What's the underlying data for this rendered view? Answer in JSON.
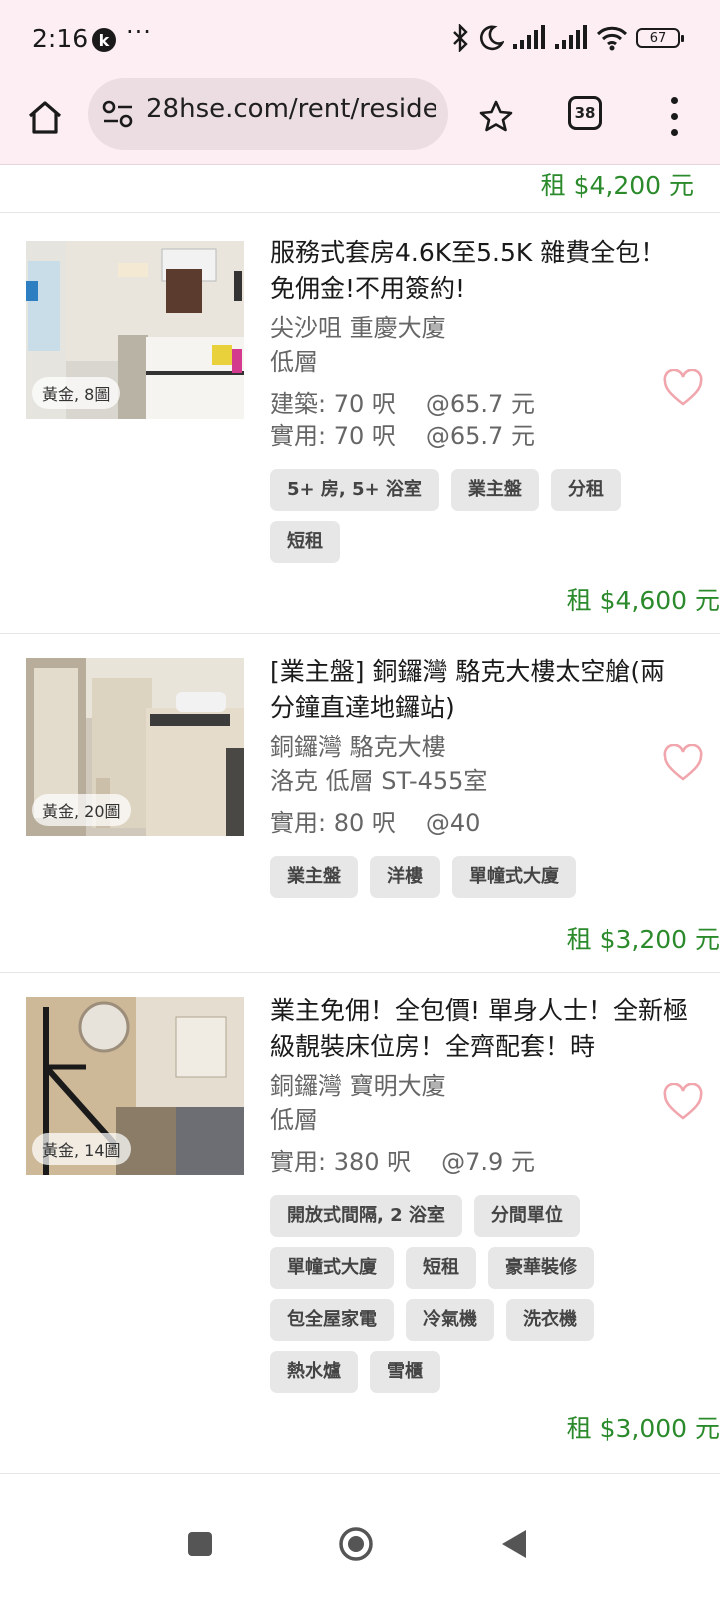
{
  "status": {
    "time": "2:16",
    "k_label": "k",
    "more": "···",
    "battery": "67"
  },
  "toolbar": {
    "url": "28hse.com/rent/reside",
    "tab_count": "38"
  },
  "top_price": "租 $4,200 元",
  "listings": [
    {
      "badge": "黃金, 8圖",
      "title": "服務式套房4.6K至5.5K 雜費全包！免佣金!不用簽約!",
      "loc_line1": "尖沙咀 重慶大廈",
      "loc_line2": "低層",
      "area_line1_label": "建築: 70 呎",
      "area_line1_rate": "@65.7 元",
      "area_line2_label": "實用: 70 呎",
      "area_line2_rate": "@65.7 元",
      "tags": [
        "5+ 房, 5+ 浴室",
        "業主盤",
        "分租",
        "短租"
      ],
      "price": "租 $4,600 元"
    },
    {
      "badge": "黃金, 20圖",
      "title": "[業主盤] 銅鑼灣 駱克大樓太空艙(兩分鐘直達地鑼站)",
      "loc_line1": "銅鑼灣 駱克大樓",
      "loc_line2": "洛克 低層 ST-455室",
      "area_line1_label": "實用: 80 呎",
      "area_line1_rate": "@40",
      "tags": [
        "業主盤",
        "洋樓",
        "單幢式大廈"
      ],
      "price": "租 $3,200 元"
    },
    {
      "badge": "黃金, 14圖",
      "title": "業主免佣！全包價! 單身人士！全新極級靚裝床位房！全齊配套！時",
      "loc_line1": "銅鑼灣 寶明大廈",
      "loc_line2": "低層",
      "area_line1_label": "實用: 380 呎",
      "area_line1_rate": "@7.9 元",
      "tags": [
        "開放式間隔, 2 浴室",
        "分間單位",
        "單幢式大廈",
        "短租",
        "豪華裝修",
        "包全屋家電",
        "冷氣機",
        "洗衣機",
        "熱水爐",
        "雪櫃"
      ],
      "price": "租 $3,000 元"
    }
  ]
}
